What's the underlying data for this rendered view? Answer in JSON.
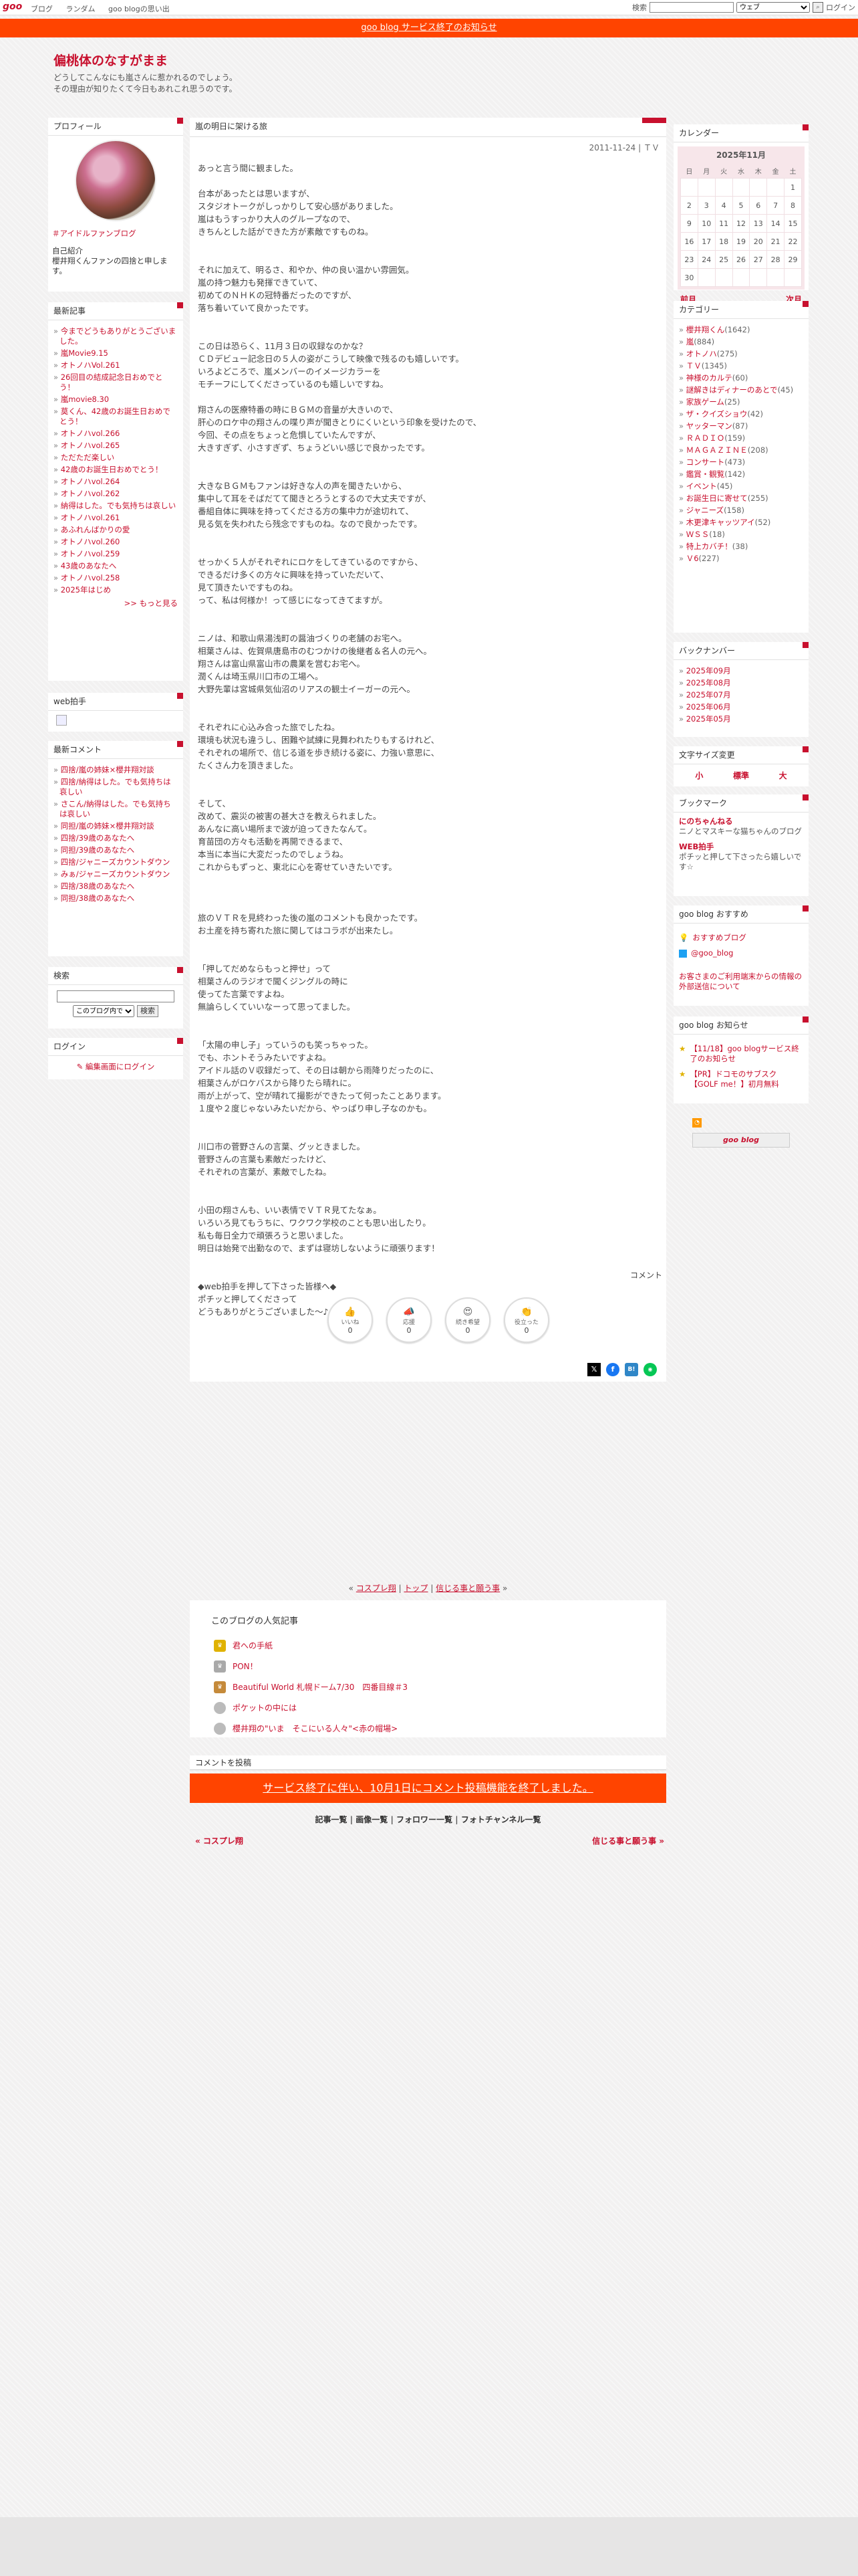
{
  "topbar": {
    "logo": "goo",
    "nav": [
      "ブログ",
      "ランダム",
      "goo blogの思い出"
    ],
    "search_label": "検索",
    "search_option": "ウェブ",
    "login": "ログイン"
  },
  "announce": "goo blog サービス終了のお知らせ",
  "header": {
    "title": "偏桃体のなすがまま",
    "desc1": "どうしてこんなにも嵐さんに惹かれるのでしょう。",
    "desc2": "その理由が知りたくて今日もあれこれ思うのです。"
  },
  "profile": {
    "heading": "プロフィール",
    "tag": "＃アイドルファンブログ",
    "intro_label": "自己紹介",
    "intro": "櫻井翔くんファンの四捨と申します。"
  },
  "recent": {
    "heading": "最新記事",
    "items": [
      "今までどうもありがとうございました。",
      "嵐Movie9.15",
      "オトノハVol.261",
      "26回目の結成記念日おめでとう！",
      "嵐movie8.30",
      "莫くん、42歳のお誕生日おめでとう！",
      "オトノハvol.266",
      "オトノハvol.265",
      "ただただ楽しい",
      "42歳のお誕生日おめでとう！",
      "オトノハvol.264",
      "オトノハvol.262",
      "納得はした。でも気持ちは哀しい",
      "オトノハvol.261",
      "あふれんばかりの愛",
      "オトノハvol.260",
      "オトノハvol.259",
      "43歳のあなたへ",
      "オトノハvol.258",
      "2025年はじめ"
    ],
    "more": ">> もっと見る"
  },
  "webclap": {
    "heading": "web拍手"
  },
  "comments": {
    "heading": "最新コメント",
    "items": [
      "四捨/嵐の姉妹×櫻井翔対談",
      "四捨/納得はした。でも気持ちは哀しい",
      "さこん/納得はした。でも気持ちは哀しい",
      "同担/嵐の姉妹×櫻井翔対談",
      "四捨/39歳のあなたへ",
      "同担/39歳のあなたへ",
      "四捨/ジャニーズカウントダウン",
      "みぁ/ジャニーズカウントダウン",
      "四捨/38歳のあなたへ",
      "同担/38歳のあなたへ"
    ]
  },
  "search": {
    "heading": "検索",
    "scope": "このブログ内で",
    "button": "検索"
  },
  "login": {
    "heading": "ログイン",
    "link": "編集画面にログイン"
  },
  "article": {
    "title": "嵐の明日に架ける旅",
    "meta": "2011-11-24 | ＴＶ",
    "body": "あっと言う間に観ました。\n\n台本があったとは思いますが、\nスタジオトークがしっかりして安心感がありました。\n嵐はもうすっかり大人のグループなので、\nきちんとした話ができた方が素敵ですものね。\n\n\nそれに加えて、明るさ、和やか、仲の良い温かい雰囲気。\n嵐の持つ魅力も発揮できていて、\n初めてのＮＨＫの冠特番だったのですが、\n落ち着いていて良かったです。\n\n\nこの日は恐らく、11月３日の収録なのかな？\nＣＤデビュー記念日の５人の姿がこうして映像で残るのも嬉しいです。\nいろよどころで、嵐メンバーのイメージカラーを\nモチーフにしてくださっているのも嬉しいですね。\n\n翔さんの医療特番の時にＢＧＭの音量が大きいので、\n肝心のロケ中の翔さんの喋り声が聞きとりにくいという印象を受けたので、\n今回、その点をちょっと危惧していたんですが、\n大きすぎず、小さすぎず、ちょうどいい感じで良かったです。\n\n\n大きなＢＧＭもファンは好きな人の声を聞きたいから、\n集中して耳をそばだてて聞きとろうとするので大丈夫ですが、\n番組自体に興味を持ってくださる方の集中力が途切れて、\n見る気を失われたら残念ですものね。なので良かったです。\n\n\nせっかく５人がそれぞれにロケをしてきているのですから、\nできるだけ多くの方々に興味を持っていただいて、\n見て頂きたいですものね。\nって、私は何様か！って感じになってきてますが。\n\n\nニノは、和歌山県湯浅町の醤油づくりの老舗のお宅へ。\n相葉さんは、佐賀県唐島市のむつかけの後継者＆名人の元へ。\n翔さんは富山県富山市の農業を営むお宅へ。\n潤くんは埼玉県川口市の工場へ。\n大野先輩は宮城県気仙沼のリアスの観士イーガーの元へ。\n\n\nそれぞれに心込み合った旅でしたね。\n環境も状況も違うし、困難や試練に見舞われたりもするけれど、\nそれぞれの場所で、信じる道を歩き続ける姿に、力強い意思に、\nたくさん力を頂きました。\n\n\nそして、\n改めて、震災の被害の甚大さを教えられました。\nあんなに高い場所まで波が迫ってきたなんて。\n育苗団の方々も活動を再開できるまで、\n本当に本当に大変だったのでしょうね。\nこれからもずっと、東北に心を寄せていきたいです。\n\n\n\n旅のＶＴＲを見終わった後の嵐のコメントも良かったです。\nお土産を持ち寄れた旅に関してはコラボが出来たし。\n\n\n「押してだめならもっと押せ」って\n相葉さんのラジオで聞くジングルの時に\n使ってた言葉ですよね。\n無論らしくていいなーって思ってました。\n\n\n「太陽の申し子」っていうのも笑っちゃった。\nでも、ホントそうみたいですよね。\nアイドル話のＶ収録だって、その日は朝から雨降りだったのに、\n相葉さんがロケバスから降りたら晴れに。\n雨が上がって、空が晴れて撮影ができたって何ったことあります。\n１度や２度じゃないみたいだから、やっぱり申し子なのかも。\n\n\n川口市の菅野さんの言葉、グッときました。\n菅野さんの言葉も素敵だったけど、\nそれぞれの言葉が、素敵でしたね。\n\n\n小田の翔さんも、いい表情でＶＴＲ見てたなぁ。\nいろいろ見てもうちに、ワクワク学校のことも思い出したり。\n私も毎日全力で頑張ろうと思いました。\n明日は始発で出勤なので、まずは寝坊しないように頑張ります！\n\n\n◆web拍手を押して下さった皆様へ◆\nポチッと押してくださって\nどうもありがとうございました〜♪",
    "comment_link": "コメント",
    "reactions": [
      {
        "label": "いいね",
        "count": "0",
        "icon": "thumbs-up-icon"
      },
      {
        "label": "応援",
        "count": "0",
        "icon": "megaphone-icon"
      },
      {
        "label": "続き希望",
        "count": "0",
        "icon": "heart-eyes-icon"
      },
      {
        "label": "役立った",
        "count": "0",
        "icon": "clap-icon"
      }
    ]
  },
  "pager": {
    "prev": "コスプレ翔",
    "top": "トップ",
    "next": "信じる事と願う事"
  },
  "popular": {
    "heading": "このブログの人気記事",
    "items": [
      "君への手紙",
      "PON！",
      "Beautiful World 札幌ドーム7/30　四番目線＃3",
      "ポケットの中には",
      "櫻井翔の\"いま　そこにいる人々\"<赤の帽場>"
    ]
  },
  "comment_post": {
    "label": "コメントを投稿",
    "notice": "サービス終了に伴い、10月1日にコメント投稿機能を終了しました。"
  },
  "footer": {
    "links": [
      "記事一覧",
      "画像一覧",
      "フォロワー一覧",
      "フォトチャンネル一覧"
    ],
    "prev": "« コスプレ翔",
    "next": "信じる事と願う事 »"
  },
  "calendar": {
    "heading": "カレンダー",
    "month": "2025年11月",
    "weekdays": [
      "日",
      "月",
      "火",
      "水",
      "木",
      "金",
      "土"
    ],
    "weeks": [
      [
        "",
        "",
        "",
        "",
        "",
        "",
        "1"
      ],
      [
        "2",
        "3",
        "4",
        "5",
        "6",
        "7",
        "8"
      ],
      [
        "9",
        "10",
        "11",
        "12",
        "13",
        "14",
        "15"
      ],
      [
        "16",
        "17",
        "18",
        "19",
        "20",
        "21",
        "22"
      ],
      [
        "23",
        "24",
        "25",
        "26",
        "27",
        "28",
        "29"
      ],
      [
        "30",
        "",
        "",
        "",
        "",
        "",
        ""
      ]
    ],
    "prev": "前月",
    "next": "次月"
  },
  "categories": {
    "heading": "カテゴリー",
    "items": [
      [
        "櫻井翔くん",
        "(1642)"
      ],
      [
        "嵐",
        "(884)"
      ],
      [
        "オトノハ",
        "(275)"
      ],
      [
        "ＴＶ",
        "(1345)"
      ],
      [
        "神様のカルテ",
        "(60)"
      ],
      [
        "謎解きはディナーのあとで",
        "(45)"
      ],
      [
        "家族ゲーム",
        "(25)"
      ],
      [
        "ザ・クイズショウ",
        "(42)"
      ],
      [
        "ヤッターマン",
        "(87)"
      ],
      [
        "ＲＡＤＩＯ",
        "(159)"
      ],
      [
        "ＭＡＧＡＺＩＮＥ",
        "(208)"
      ],
      [
        "コンサート",
        "(473)"
      ],
      [
        "鑑賞・観覧",
        "(142)"
      ],
      [
        "イベント",
        "(45)"
      ],
      [
        "お誕生日に寄せて",
        "(255)"
      ],
      [
        "ジャニーズ",
        "(158)"
      ],
      [
        "木更津キャッツアイ",
        "(52)"
      ],
      [
        "ＷＳＳ",
        "(18)"
      ],
      [
        "特上カバチ！",
        "(38)"
      ],
      [
        "Ｖ6",
        "(227)"
      ]
    ]
  },
  "backnumber": {
    "heading": "バックナンバー",
    "items": [
      "2025年09月",
      "2025年08月",
      "2025年07月",
      "2025年06月",
      "2025年05月"
    ]
  },
  "fontsize": {
    "heading": "文字サイズ変更",
    "small": "小",
    "medium": "標準",
    "large": "大"
  },
  "bookmark": {
    "heading": "ブックマーク",
    "items": [
      {
        "title": "にのちゃんねる",
        "desc": "ニノとマスキーな猫ちゃんのブログ"
      },
      {
        "title": "WEB拍手",
        "desc": "ポチッと押して下さったら嬉しいです☆"
      }
    ]
  },
  "recommend": {
    "heading": "goo blog おすすめ",
    "items": [
      "おすすめブログ",
      "@goo_blog"
    ],
    "notice": "お客さまのご利用端末からの情報の外部送信について"
  },
  "news": {
    "heading": "goo blog お知らせ",
    "items": [
      "【11/18】goo blogサービス終了のお知らせ",
      "【PR】ドコモのサブスク【GOLF me！】初月無料"
    ]
  },
  "badge": "goo blog"
}
